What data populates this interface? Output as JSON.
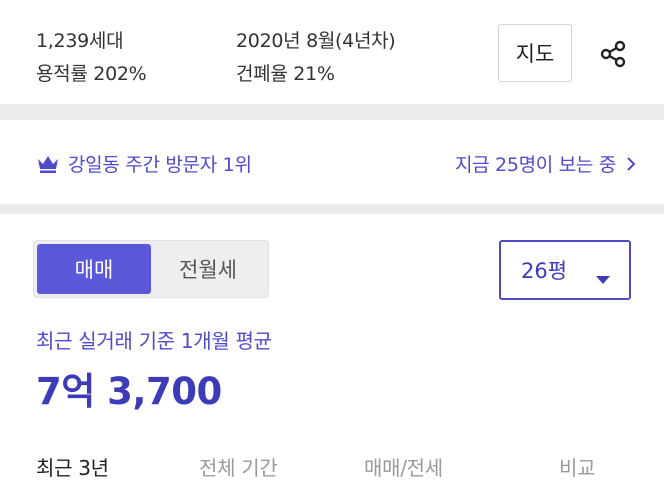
{
  "complex_info": {
    "households": "1,239세대",
    "floor_area_ratio": "용적률 202%",
    "completion": "2020년 8월(4년차)",
    "building_coverage": "건폐율 21%",
    "map_button": "지도",
    "share_icon": "share-icon"
  },
  "visitors": {
    "rank_text": "강일동 주간 방문자 1위",
    "viewing_now": "지금 25명이 보는 중",
    "crown_icon": "crown-icon",
    "chevron_icon": "chevron-right-icon"
  },
  "trade": {
    "segment": [
      "매매",
      "전월세"
    ],
    "selected_segment": "매매",
    "size": "26평",
    "avg_label": "최근 실거래 기준 1개월 평균",
    "avg_price": "7억 3,700",
    "tabs": [
      "최근 3년",
      "전체 기간",
      "매매/전세",
      "비교"
    ],
    "active_tab": "최근 3년"
  },
  "colors": {
    "accent": "#4e4cc8",
    "segment_active": "#5b59d9",
    "divider": "#ececec"
  }
}
